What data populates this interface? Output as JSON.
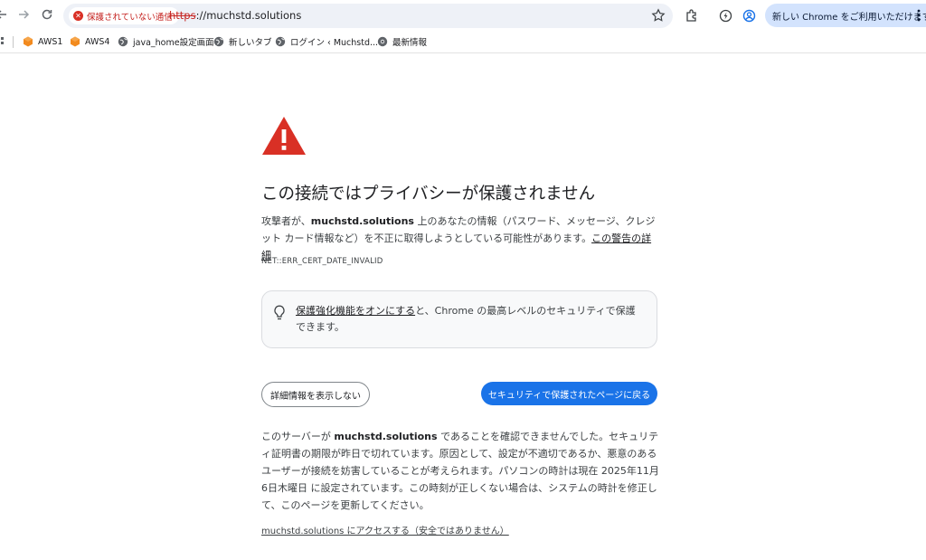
{
  "toolbar": {
    "security_chip": "保護されていない通信",
    "url_scheme": "https",
    "url_rest": "://muchstd.solutions",
    "promo": "新しい Chrome をご利用いただけます"
  },
  "bookmarks": [
    {
      "label": "AWS1",
      "icon": "aws-icon"
    },
    {
      "label": "AWS4",
      "icon": "aws-icon"
    },
    {
      "label": "java_home設定画面",
      "icon": "globe-icon"
    },
    {
      "label": "新しいタブ",
      "icon": "globe-icon"
    },
    {
      "label": "ログイン ‹ Muchstd...",
      "icon": "globe-icon"
    },
    {
      "label": "最新情報",
      "icon": "chrome-icon"
    }
  ],
  "interstitial": {
    "title": "この接続ではプライバシーが保護されません",
    "desc_prefix": "攻撃者が、",
    "desc_domain": "muchstd.solutions",
    "desc_middle": " 上のあなたの情報（パスワード、メッセージ、クレジット カード情報など）を不正に取得しようとしている可能性があります。",
    "desc_link": "この警告の詳細",
    "error_code": "NET::ERR_CERT_DATE_INVALID",
    "promo_link": "保護強化機能をオンにする",
    "promo_rest": "と、Chrome の最高レベルのセキュリティで保護できます。",
    "details_button": "詳細情報を表示しない",
    "back_button": "セキュリティで保護されたページに戻る",
    "details_prefix": "このサーバーが ",
    "details_domain": "muchstd.solutions",
    "details_rest": " であることを確認できませんでした。セキュリティ証明書の期限が昨日で切れています。原因として、設定が不適切であるか、悪意のあるユーザーが接続を妨害していることが考えられます。パソコンの時計は現在 2025年11月6日木曜日 に設定されています。この時刻が正しくない場合は、システムの時計を修正して、このページを更新してください。",
    "proceed_link": "muchstd.solutions にアクセスする（安全ではありません）"
  },
  "colors": {
    "danger": "#d93025",
    "primary": "#1a73e8",
    "promo_bg": "#d3e3fd"
  }
}
